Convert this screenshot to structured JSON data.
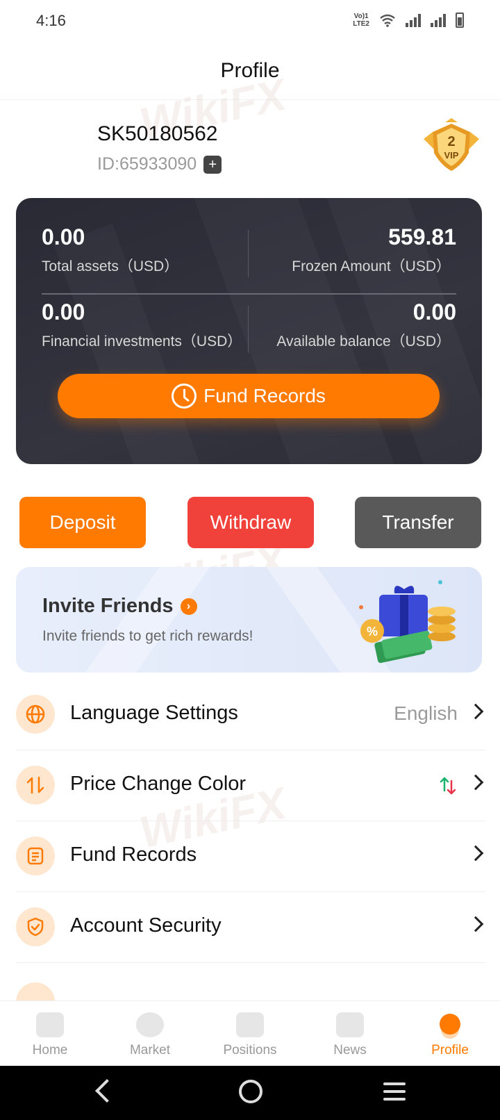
{
  "status_bar": {
    "time": "4:16",
    "volte": "VoLTE1 LTE2"
  },
  "header": {
    "title": "Profile"
  },
  "user": {
    "name": "SK50180562",
    "id_label": "ID:65933090",
    "vip_level": "2",
    "vip_text": "VIP"
  },
  "assets": {
    "total_assets": {
      "value": "0.00",
      "label": "Total assets（USD）"
    },
    "frozen_amount": {
      "value": "559.81",
      "label": "Frozen Amount（USD）"
    },
    "financial_investments": {
      "value": "0.00",
      "label": "Financial investments（USD）"
    },
    "available_balance": {
      "value": "0.00",
      "label": "Available balance（USD）"
    },
    "fund_records_button": "Fund Records"
  },
  "actions": {
    "deposit": "Deposit",
    "withdraw": "Withdraw",
    "transfer": "Transfer"
  },
  "invite": {
    "title": "Invite Friends",
    "subtitle": "Invite friends to get rich rewards!"
  },
  "menu": [
    {
      "label": "Language Settings",
      "value": "English",
      "icon": "globe-icon"
    },
    {
      "label": "Price Change Color",
      "value": "",
      "icon": "swap-icon"
    },
    {
      "label": "Fund Records",
      "value": "",
      "icon": "document-icon"
    },
    {
      "label": "Account Security",
      "value": "",
      "icon": "shield-icon"
    }
  ],
  "bottom_nav": [
    {
      "label": "Home",
      "icon": "home-icon"
    },
    {
      "label": "Market",
      "icon": "dollar-icon"
    },
    {
      "label": "Positions",
      "icon": "chart-icon"
    },
    {
      "label": "News",
      "icon": "news-icon"
    },
    {
      "label": "Profile",
      "icon": "profile-icon",
      "active": true
    }
  ],
  "colors": {
    "accent": "#ff7a00",
    "withdraw": "#f0413a",
    "transfer": "#595959",
    "card": "#2e2e38"
  },
  "watermark": "WikiFX"
}
